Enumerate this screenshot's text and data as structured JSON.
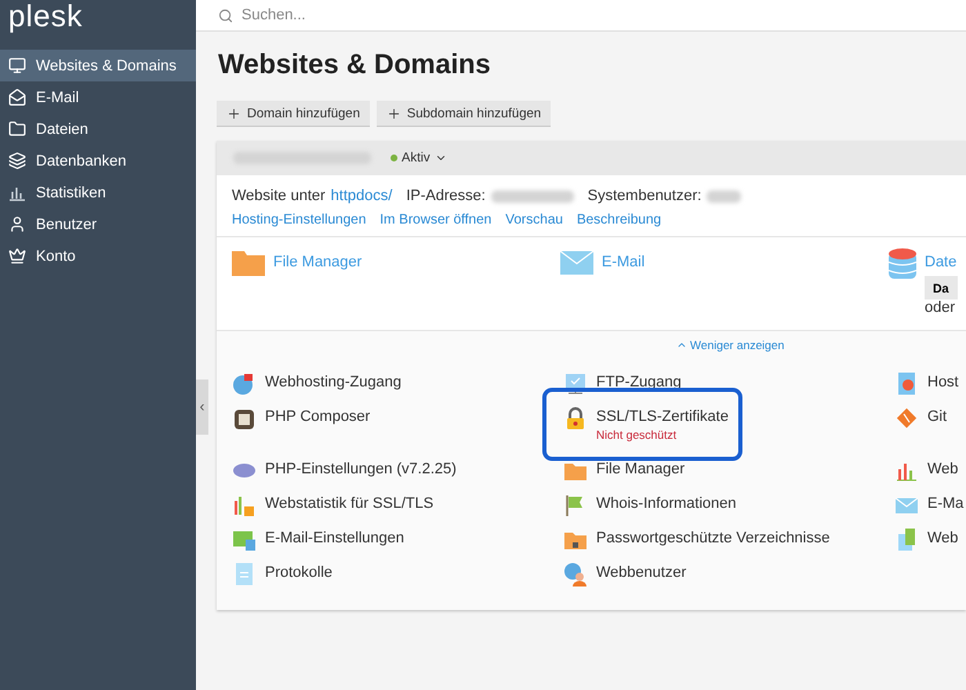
{
  "sidebar": {
    "logo": "plesk",
    "items": [
      {
        "label": "Websites & Domains",
        "selected": true
      },
      {
        "label": "E-Mail",
        "selected": false
      },
      {
        "label": "Dateien",
        "selected": false
      },
      {
        "label": "Datenbanken",
        "selected": false
      },
      {
        "label": "Statistiken",
        "selected": false
      },
      {
        "label": "Benutzer",
        "selected": false
      },
      {
        "label": "Konto",
        "selected": false
      }
    ],
    "collapse": "‹"
  },
  "search": {
    "placeholder": "Suchen..."
  },
  "title": "Websites & Domains",
  "buttons": [
    "Domain hinzufügen",
    "Subdomain hinzufügen"
  ],
  "domain": {
    "status": {
      "label": "Aktiv",
      "color": "#7cb342"
    },
    "info": [
      {
        "label": "Website unter",
        "value": "httpdocs/"
      },
      {
        "label": "IP-Adresse:"
      },
      {
        "label": "Systembenutzer:"
      }
    ],
    "links": [
      "Hosting-Einstellungen",
      "Im Browser öffnen",
      "Vorschau",
      "Beschreibung"
    ],
    "tiles": [
      {
        "label": "File Manager"
      },
      {
        "label": "E-Mail"
      },
      {
        "label": "Date",
        "button": "Da",
        "note": "oder"
      }
    ],
    "toggle": "Weniger anzeigen",
    "tools": [
      {
        "label": "Webhosting-Zugang",
        "highlighted": false
      },
      {
        "label": "FTP-Zugang",
        "highlighted": false
      },
      {
        "label": "Host",
        "highlighted": false
      },
      {
        "label": "PHP Composer",
        "highlighted": false
      },
      {
        "label": "SSL/TLS-Zertifikate",
        "status": "Nicht geschützt",
        "highlighted": true
      },
      {
        "label": "Git",
        "highlighted": false
      },
      {
        "label": "PHP-Einstellungen (v7.2.25)",
        "highlighted": false
      },
      {
        "label": "File Manager",
        "highlighted": false
      },
      {
        "label": "Web",
        "highlighted": false
      },
      {
        "label": "Webstatistik für SSL/TLS",
        "highlighted": false
      },
      {
        "label": "Whois-Informationen",
        "highlighted": false
      },
      {
        "label": "E-Ma",
        "highlighted": false
      },
      {
        "label": "E-Mail-Einstellungen",
        "highlighted": false
      },
      {
        "label": "Passwortgeschützte Verzeichnisse",
        "highlighted": false
      },
      {
        "label": "Web",
        "highlighted": false
      },
      {
        "label": "Protokolle",
        "highlighted": false
      },
      {
        "label": "Webbenutzer",
        "highlighted": false
      }
    ]
  }
}
